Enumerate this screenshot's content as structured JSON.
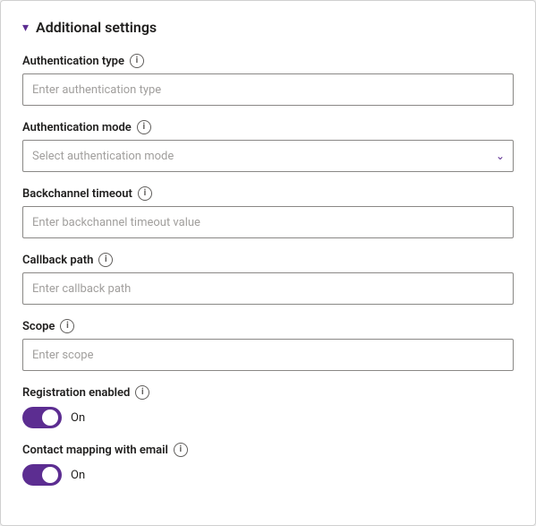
{
  "section": {
    "title": "Additional settings",
    "chevron": "▾"
  },
  "fields": {
    "authentication_type": {
      "label": "Authentication type",
      "placeholder": "Enter authentication type"
    },
    "authentication_mode": {
      "label": "Authentication mode",
      "placeholder": "Select authentication mode",
      "options": [
        "Select authentication mode"
      ]
    },
    "backchannel_timeout": {
      "label": "Backchannel timeout",
      "placeholder": "Enter backchannel timeout value"
    },
    "callback_path": {
      "label": "Callback path",
      "placeholder": "Enter callback path"
    },
    "scope": {
      "label": "Scope",
      "placeholder": "Enter scope"
    }
  },
  "toggles": {
    "registration_enabled": {
      "label": "Registration enabled",
      "status": "On",
      "checked": true
    },
    "contact_mapping": {
      "label": "Contact mapping with email",
      "status": "On",
      "checked": true
    }
  },
  "icons": {
    "info": "i",
    "chevron_down": "⌄"
  }
}
